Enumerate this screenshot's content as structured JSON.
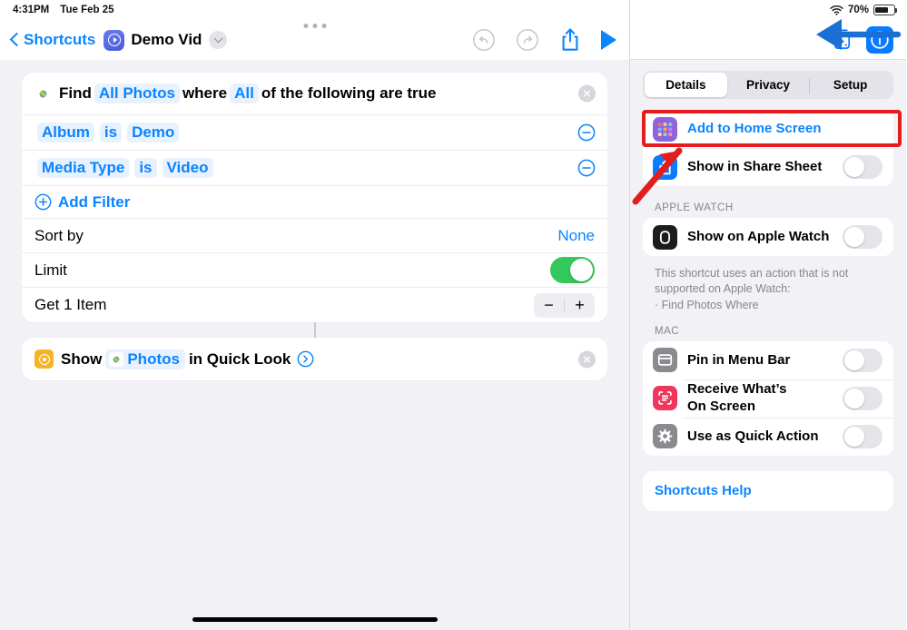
{
  "status_bar": {
    "time": "4:31PM",
    "date": "Tue Feb 25",
    "battery_percent": "70%",
    "wifi_icon": "wifi-icon",
    "battery_icon": "battery-icon",
    "battery_level": 70
  },
  "nav": {
    "back_label": "Shortcuts",
    "shortcut_icon": "shortcut-play-icon",
    "title": "Demo Vid",
    "title_chevron_icon": "chevron-down-icon",
    "undo_icon": "undo-icon",
    "redo_icon": "redo-icon",
    "share_icon": "share-icon",
    "play_icon": "play-icon"
  },
  "editor": {
    "find_action": {
      "app_icon": "photos-icon",
      "verb": "Find",
      "source_token": "All Photos",
      "where": "where",
      "match_token": "All",
      "suffix": "of the following are true",
      "remove_icon": "close-circle-icon",
      "filters": [
        {
          "field": "Album",
          "operator": "is",
          "value": "Demo",
          "remove_icon": "minus-circle-icon"
        },
        {
          "field": "Media Type",
          "operator": "is",
          "value": "Video",
          "remove_icon": "minus-circle-icon"
        }
      ],
      "add_filter": {
        "label": "Add Filter",
        "icon": "plus-circle-icon"
      },
      "sort_by": {
        "label": "Sort by",
        "value": "None"
      },
      "limit": {
        "label": "Limit",
        "enabled": true
      },
      "get_items": {
        "label": "Get 1 Item",
        "decrement_icon": "minus-icon",
        "increment_icon": "plus-icon",
        "decrement_label": "−",
        "increment_label": "+"
      }
    },
    "show_action": {
      "app_icon": "quicklook-icon",
      "verb": "Show",
      "token_icon": "photos-icon",
      "token": "Photos",
      "suffix": "in Quick Look",
      "expand_icon": "chevron-right-circle-icon",
      "remove_icon": "close-circle-icon"
    }
  },
  "details_panel": {
    "icon_picker_icon": "shortcut-icon-picker-icon",
    "info_icon": "info-circle-icon",
    "tabs": [
      {
        "label": "Details",
        "active": true
      },
      {
        "label": "Privacy",
        "active": false
      },
      {
        "label": "Setup",
        "active": false
      }
    ],
    "main_group": [
      {
        "icon": "home-screen-grid-icon",
        "label": "Add to Home Screen",
        "style": "link",
        "highlighted": true
      },
      {
        "icon": "share-sheet-icon",
        "label": "Show in Share Sheet",
        "style": "toggle",
        "enabled": false
      }
    ],
    "apple_watch": {
      "header": "APPLE WATCH",
      "rows": [
        {
          "icon": "apple-watch-icon",
          "label": "Show on Apple Watch",
          "style": "toggle",
          "enabled": false
        }
      ],
      "footnote_line1": "This shortcut uses an action that is not",
      "footnote_line2": "supported on Apple Watch:",
      "footnote_line3": "· Find Photos Where"
    },
    "mac": {
      "header": "MAC",
      "rows": [
        {
          "icon": "menu-bar-icon",
          "label": "Pin in Menu Bar",
          "style": "toggle",
          "enabled": false
        },
        {
          "icon": "receive-screen-icon",
          "label": "Receive What’s\nOn Screen",
          "label_line1": "Receive What’s",
          "label_line2": "On Screen",
          "style": "toggle",
          "enabled": false
        },
        {
          "icon": "quick-action-gear-icon",
          "label": "Use as Quick Action",
          "style": "toggle",
          "enabled": false
        }
      ]
    },
    "help": {
      "label": "Shortcuts Help"
    }
  },
  "annotations": {
    "highlight_color": "#e31c1c",
    "red_arrow_icon": "red-pointer-arrow",
    "blue_arrow_icon": "blue-pointer-arrow",
    "blue_arrow_color": "#1a6fd4"
  },
  "colors": {
    "accent_blue": "#0a84ff",
    "toggle_on_green": "#34c759",
    "page_background": "#f2f1f6",
    "card_background": "#ffffff"
  }
}
